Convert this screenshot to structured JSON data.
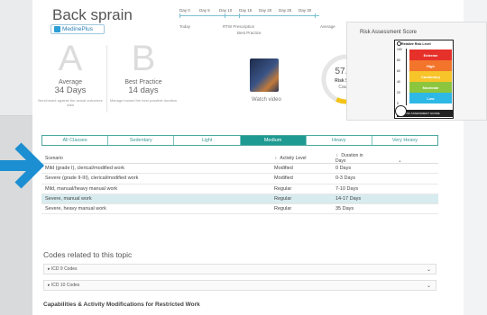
{
  "page": {
    "title": "Back sprain",
    "logo_text": "MedinePlus"
  },
  "timeline": {
    "days": [
      "Day 0",
      "Day 5",
      "Day 10",
      "Day 15",
      "Day 20",
      "Day 25",
      "Day 30"
    ],
    "labels": {
      "today": "Today",
      "rtw": "RTW Prescription",
      "best": "Best Practice",
      "average": "Average"
    }
  },
  "average_card": {
    "letter": "A",
    "label": "Average",
    "days": "34 Days",
    "note": "Benchmark against the actual outcomes data"
  },
  "best_card": {
    "letter": "B",
    "label": "Best Practice",
    "days": "14 days",
    "note": "Manage toward the best possible duration"
  },
  "video": {
    "label": "Watch video"
  },
  "risk_score": {
    "value": "57.02",
    "label": "Risk Score",
    "status": "Caution",
    "fraction": 0.5702,
    "color": "#f2c318"
  },
  "risk_assessment": {
    "title": "Risk Assessment Score",
    "level_label": "Relative Risk Level",
    "bands": [
      {
        "label": "Extreme",
        "color": "#e6312b"
      },
      {
        "label": "High",
        "color": "#f2752b"
      },
      {
        "label": "Cautionary",
        "color": "#f7c42a"
      },
      {
        "label": "Moderate",
        "color": "#8cc63f"
      },
      {
        "label": "Low",
        "color": "#2eb8e6"
      }
    ],
    "scale": [
      "100",
      "80",
      "60",
      "40",
      "20",
      "0"
    ],
    "legend": "RISK ASSESSMENT SCORE"
  },
  "activity_tabs": [
    "All Classes",
    "Sedentary",
    "Light",
    "Medium",
    "Heavy",
    "Very Heavy"
  ],
  "table": {
    "headers": {
      "scenario": "Scenario",
      "activity": "Activity Level",
      "duration": "Duration in Days"
    },
    "rows": [
      {
        "scenario": "Mild (grade I), clerical/modified work",
        "activity": "Modified",
        "duration": "0 Days"
      },
      {
        "scenario": "Severe (grade II-III), clerical/modified work",
        "activity": "Modified",
        "duration": "0-3 Days"
      },
      {
        "scenario": "Mild, manual/heavy manual work",
        "activity": "Regular",
        "duration": "7-10 Days"
      },
      {
        "scenario": "Severe, manual work",
        "activity": "Regular",
        "duration": "14-17 Days"
      },
      {
        "scenario": "Severe, heavy manual work",
        "activity": "Regular",
        "duration": "35 Days"
      }
    ]
  },
  "codes": {
    "title": "Codes related to this topic",
    "icd9": "ICD 9 Codes",
    "icd10": "ICD 10 Codes"
  },
  "capabilities": {
    "title": "Capabilities & Activity Modifications for Restricted Work"
  },
  "colors": {
    "accent": "#1f9a92",
    "arrow": "#1b8fd1",
    "highlight_row": "#d8ebef"
  }
}
